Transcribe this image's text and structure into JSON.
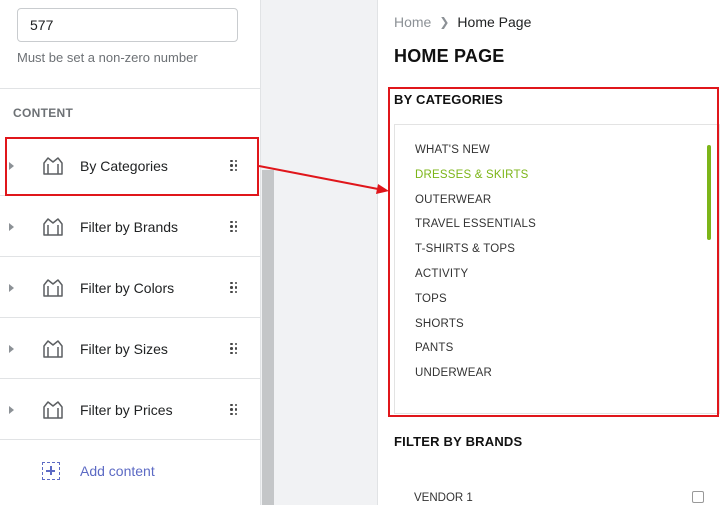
{
  "settings": {
    "number_value": "577",
    "helper_text": "Must be set a non-zero number"
  },
  "content_section": {
    "title": "CONTENT",
    "items": [
      {
        "label": "By Categories",
        "icon": "store-icon"
      },
      {
        "label": "Filter by Brands",
        "icon": "store-icon"
      },
      {
        "label": "Filter by Colors",
        "icon": "store-icon"
      },
      {
        "label": "Filter by Sizes",
        "icon": "store-icon"
      },
      {
        "label": "Filter by Prices",
        "icon": "store-icon"
      }
    ],
    "add_label": "Add content"
  },
  "preview": {
    "breadcrumb": {
      "home": "Home",
      "current": "Home Page"
    },
    "page_title": "HOME PAGE",
    "by_categories": {
      "title": "BY CATEGORIES",
      "items": [
        "WHAT'S NEW",
        "DRESSES & SKIRTS",
        "OUTERWEAR",
        "TRAVEL ESSENTIALS",
        "T-SHIRTS & TOPS",
        "ACTIVITY",
        "TOPS",
        "SHORTS",
        "PANTS",
        "UNDERWEAR"
      ],
      "active_item": "DRESSES & SKIRTS"
    },
    "filter_by_brands": {
      "title": "FILTER BY BRANDS",
      "first_vendor": "VENDOR 1"
    }
  },
  "colors": {
    "accent_green": "#7cb518",
    "annotation_red": "#e0161b",
    "link_purple": "#5c6ac4"
  }
}
